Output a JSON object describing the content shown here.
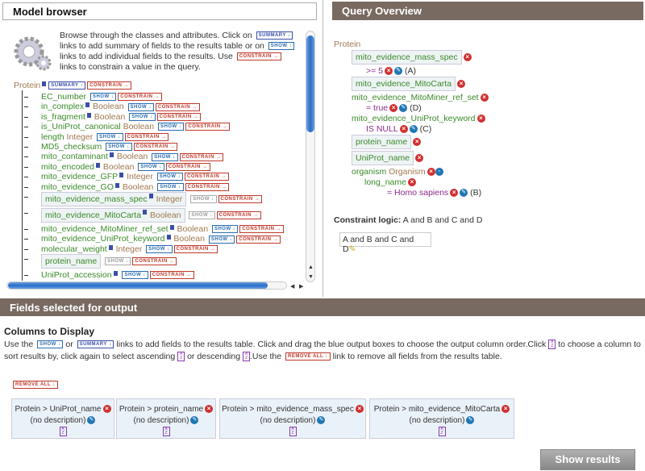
{
  "model_browser": {
    "title": "Model browser",
    "intro": [
      "Browse through the classes and attributes. Click on",
      "links to add summary of fields to the results table or on",
      "links to add individual fields to the results. Use",
      "links to constrain a value in the query."
    ],
    "summary_label": "SUMMARY ↓",
    "show_label": "SHOW ↓",
    "constrain_label": "CONSTRAIN →",
    "root": "Protein",
    "fields": [
      {
        "name": "EC_number",
        "type": "",
        "info": false,
        "selected": false
      },
      {
        "name": "in_complex",
        "type": "Boolean",
        "info": true,
        "selected": false
      },
      {
        "name": "is_fragment",
        "type": "Boolean",
        "info": true,
        "selected": false
      },
      {
        "name": "is_UniProt_canonical",
        "type": "Boolean",
        "info": false,
        "selected": false
      },
      {
        "name": "length",
        "type": "Integer",
        "info": false,
        "selected": false
      },
      {
        "name": "MD5_checksum",
        "type": "",
        "info": false,
        "selected": false
      },
      {
        "name": "mito_contaminant",
        "type": "Boolean",
        "info": true,
        "selected": false
      },
      {
        "name": "mito_encoded",
        "type": "Boolean",
        "info": true,
        "selected": false
      },
      {
        "name": "mito_evidence_GFP",
        "type": "Integer",
        "info": true,
        "selected": false
      },
      {
        "name": "mito_evidence_GO",
        "type": "Boolean",
        "info": true,
        "selected": false
      },
      {
        "name": "mito_evidence_mass_spec",
        "type": "Integer",
        "info": true,
        "selected": true
      },
      {
        "name": "mito_evidence_MitoCarta",
        "type": "Boolean",
        "info": true,
        "selected": true
      },
      {
        "name": "mito_evidence_MitoMiner_ref_set",
        "type": "Boolean",
        "info": true,
        "selected": false
      },
      {
        "name": "mito_evidence_UniProt_keyword",
        "type": "Boolean",
        "info": true,
        "selected": false
      },
      {
        "name": "molecular_weight",
        "type": "Integer",
        "info": true,
        "selected": false
      },
      {
        "name": "protein_name",
        "type": "",
        "info": false,
        "selected": true
      },
      {
        "name": "UniProt_accession",
        "type": "",
        "info": true,
        "selected": false
      }
    ]
  },
  "query_overview": {
    "title": "Query Overview",
    "root": "Protein",
    "items": [
      {
        "kind": "box",
        "text": "mito_evidence_mass_spec"
      },
      {
        "kind": "con",
        "text": ">= 5",
        "code": "(A)"
      },
      {
        "kind": "box",
        "text": "mito_evidence_MitoCarta"
      },
      {
        "kind": "fld",
        "text": "mito_evidence_MitoMiner_ref_set"
      },
      {
        "kind": "con",
        "text": "= true",
        "code": "(D)"
      },
      {
        "kind": "fld",
        "text": "mito_evidence_UniProt_keyword"
      },
      {
        "kind": "con",
        "text": "IS NULL",
        "code": "(C)"
      },
      {
        "kind": "box",
        "text": "protein_name"
      },
      {
        "kind": "box",
        "text": "UniProt_name"
      }
    ],
    "organism": {
      "name": "organism",
      "type": "Organism",
      "sub": "long_name",
      "value": "= Homo sapiens",
      "code": "(B)"
    },
    "constraint_logic_label": "Constraint logic:",
    "constraint_logic": "A and B and C and D",
    "logic_input": "A and B and C and D"
  },
  "fields_output": {
    "title": "Fields selected for output",
    "columns_title": "Columns to Display",
    "help": [
      "Use the",
      "or",
      "links to add fields to the results table. Click and drag the blue output boxes to choose the output column order.Click",
      "to choose a column to sort results by, click again to select ascending",
      "or descending",
      ".Use the",
      "link to remove all fields from the results table."
    ],
    "remove_all_label": "REMOVE ALL ↓",
    "columns": [
      {
        "path": "Protein > UniProt_name",
        "desc": "(no description)",
        "sort": "none"
      },
      {
        "path": "Protein > protein_name",
        "desc": "(no description)",
        "sort": "none"
      },
      {
        "path": "Protein > mito_evidence_mass_spec",
        "desc": "(no description)",
        "sort": "descending"
      },
      {
        "path": "Protein > mito_evidence_MitoCarta",
        "desc": "(no description)",
        "sort": "none"
      }
    ],
    "show_results": "Show results"
  },
  "colors": {
    "header_bg": "#786a60",
    "field": "#3a8a2a",
    "class": "#a07850",
    "value": "#8a2a8a",
    "remove": "#d03030",
    "edit": "#1f77b4"
  }
}
